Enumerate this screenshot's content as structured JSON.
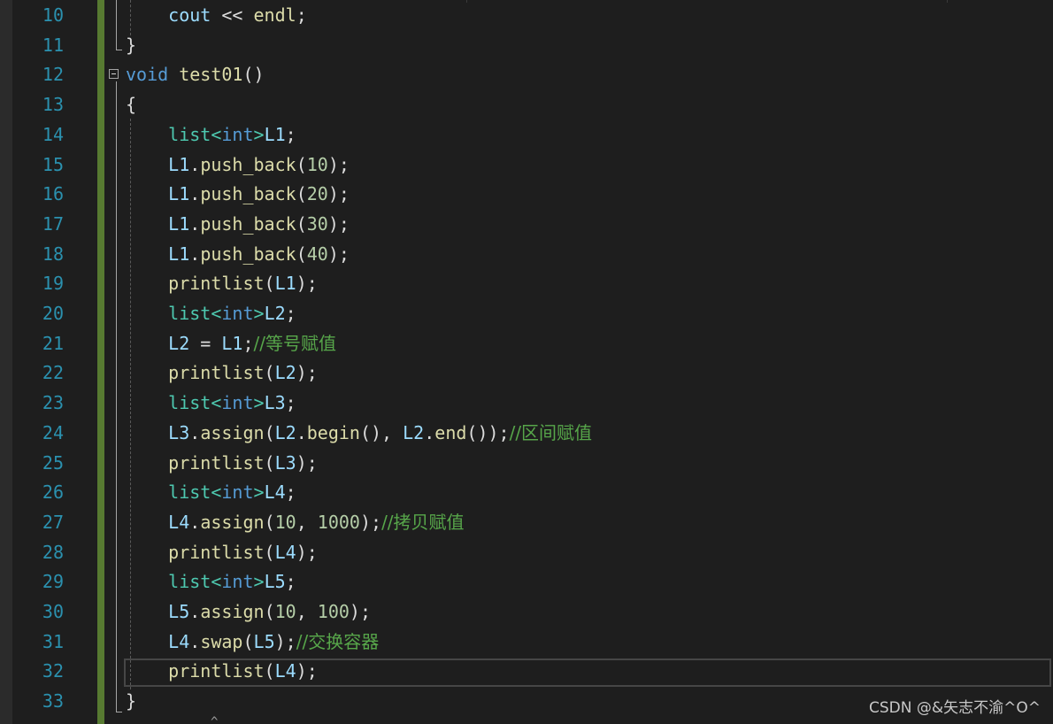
{
  "editor": {
    "colors": {
      "background": "#1e1e1e",
      "line_number": "#2b91af",
      "keyword": "#569cd6",
      "type": "#4ec9b0",
      "function": "#dcdcaa",
      "variable": "#9cdcfe",
      "number": "#b5cea8",
      "comment": "#57a64a",
      "punctuation": "#dcdcdc",
      "change_bar": "#577a31"
    },
    "lines": [
      {
        "num": "10",
        "tokens": [
          {
            "t": "    "
          },
          {
            "t": "cout",
            "c": "var"
          },
          {
            "t": " << "
          },
          {
            "t": "endl",
            "c": "fn"
          },
          {
            "t": ";"
          }
        ]
      },
      {
        "num": "11",
        "tokens": [
          {
            "t": "}"
          }
        ]
      },
      {
        "num": "12",
        "tokens": [
          {
            "t": "void",
            "c": "kw"
          },
          {
            "t": " "
          },
          {
            "t": "test01",
            "c": "fn"
          },
          {
            "t": "()"
          }
        ]
      },
      {
        "num": "13",
        "tokens": [
          {
            "t": "{"
          }
        ]
      },
      {
        "num": "14",
        "tokens": [
          {
            "t": "    "
          },
          {
            "t": "list",
            "c": "type"
          },
          {
            "t": "<",
            "c": "type"
          },
          {
            "t": "int",
            "c": "kw"
          },
          {
            "t": ">",
            "c": "type"
          },
          {
            "t": "L1",
            "c": "var"
          },
          {
            "t": ";"
          }
        ]
      },
      {
        "num": "15",
        "tokens": [
          {
            "t": "    "
          },
          {
            "t": "L1",
            "c": "var"
          },
          {
            "t": "."
          },
          {
            "t": "push_back",
            "c": "fn"
          },
          {
            "t": "("
          },
          {
            "t": "10",
            "c": "num"
          },
          {
            "t": ");"
          }
        ]
      },
      {
        "num": "16",
        "tokens": [
          {
            "t": "    "
          },
          {
            "t": "L1",
            "c": "var"
          },
          {
            "t": "."
          },
          {
            "t": "push_back",
            "c": "fn"
          },
          {
            "t": "("
          },
          {
            "t": "20",
            "c": "num"
          },
          {
            "t": ");"
          }
        ]
      },
      {
        "num": "17",
        "tokens": [
          {
            "t": "    "
          },
          {
            "t": "L1",
            "c": "var"
          },
          {
            "t": "."
          },
          {
            "t": "push_back",
            "c": "fn"
          },
          {
            "t": "("
          },
          {
            "t": "30",
            "c": "num"
          },
          {
            "t": ");"
          }
        ]
      },
      {
        "num": "18",
        "tokens": [
          {
            "t": "    "
          },
          {
            "t": "L1",
            "c": "var"
          },
          {
            "t": "."
          },
          {
            "t": "push_back",
            "c": "fn"
          },
          {
            "t": "("
          },
          {
            "t": "40",
            "c": "num"
          },
          {
            "t": ");"
          }
        ]
      },
      {
        "num": "19",
        "tokens": [
          {
            "t": "    "
          },
          {
            "t": "printlist",
            "c": "fn"
          },
          {
            "t": "("
          },
          {
            "t": "L1",
            "c": "var"
          },
          {
            "t": ");"
          }
        ]
      },
      {
        "num": "20",
        "tokens": [
          {
            "t": "    "
          },
          {
            "t": "list",
            "c": "type"
          },
          {
            "t": "<",
            "c": "type"
          },
          {
            "t": "int",
            "c": "kw"
          },
          {
            "t": ">",
            "c": "type"
          },
          {
            "t": "L2",
            "c": "var"
          },
          {
            "t": ";"
          }
        ]
      },
      {
        "num": "21",
        "tokens": [
          {
            "t": "    "
          },
          {
            "t": "L2",
            "c": "var"
          },
          {
            "t": " = "
          },
          {
            "t": "L1",
            "c": "var"
          },
          {
            "t": ";"
          },
          {
            "t": "//等号赋值",
            "c": "cm"
          }
        ]
      },
      {
        "num": "22",
        "tokens": [
          {
            "t": "    "
          },
          {
            "t": "printlist",
            "c": "fn"
          },
          {
            "t": "("
          },
          {
            "t": "L2",
            "c": "var"
          },
          {
            "t": ");"
          }
        ]
      },
      {
        "num": "23",
        "tokens": [
          {
            "t": "    "
          },
          {
            "t": "list",
            "c": "type"
          },
          {
            "t": "<",
            "c": "type"
          },
          {
            "t": "int",
            "c": "kw"
          },
          {
            "t": ">",
            "c": "type"
          },
          {
            "t": "L3",
            "c": "var"
          },
          {
            "t": ";"
          }
        ]
      },
      {
        "num": "24",
        "tokens": [
          {
            "t": "    "
          },
          {
            "t": "L3",
            "c": "var"
          },
          {
            "t": "."
          },
          {
            "t": "assign",
            "c": "fn"
          },
          {
            "t": "("
          },
          {
            "t": "L2",
            "c": "var"
          },
          {
            "t": "."
          },
          {
            "t": "begin",
            "c": "fn"
          },
          {
            "t": "(), "
          },
          {
            "t": "L2",
            "c": "var"
          },
          {
            "t": "."
          },
          {
            "t": "end",
            "c": "fn"
          },
          {
            "t": "());"
          },
          {
            "t": "//区间赋值",
            "c": "cm"
          }
        ]
      },
      {
        "num": "25",
        "tokens": [
          {
            "t": "    "
          },
          {
            "t": "printlist",
            "c": "fn"
          },
          {
            "t": "("
          },
          {
            "t": "L3",
            "c": "var"
          },
          {
            "t": ");"
          }
        ]
      },
      {
        "num": "26",
        "tokens": [
          {
            "t": "    "
          },
          {
            "t": "list",
            "c": "type"
          },
          {
            "t": "<",
            "c": "type"
          },
          {
            "t": "int",
            "c": "kw"
          },
          {
            "t": ">",
            "c": "type"
          },
          {
            "t": "L4",
            "c": "var"
          },
          {
            "t": ";"
          }
        ]
      },
      {
        "num": "27",
        "tokens": [
          {
            "t": "    "
          },
          {
            "t": "L4",
            "c": "var"
          },
          {
            "t": "."
          },
          {
            "t": "assign",
            "c": "fn"
          },
          {
            "t": "("
          },
          {
            "t": "10",
            "c": "num"
          },
          {
            "t": ", "
          },
          {
            "t": "1000",
            "c": "num"
          },
          {
            "t": ");"
          },
          {
            "t": "//拷贝赋值",
            "c": "cm"
          }
        ]
      },
      {
        "num": "28",
        "tokens": [
          {
            "t": "    "
          },
          {
            "t": "printlist",
            "c": "fn"
          },
          {
            "t": "("
          },
          {
            "t": "L4",
            "c": "var"
          },
          {
            "t": ");"
          }
        ]
      },
      {
        "num": "29",
        "tokens": [
          {
            "t": "    "
          },
          {
            "t": "list",
            "c": "type"
          },
          {
            "t": "<",
            "c": "type"
          },
          {
            "t": "int",
            "c": "kw"
          },
          {
            "t": ">",
            "c": "type"
          },
          {
            "t": "L5",
            "c": "var"
          },
          {
            "t": ";"
          }
        ]
      },
      {
        "num": "30",
        "tokens": [
          {
            "t": "    "
          },
          {
            "t": "L5",
            "c": "var"
          },
          {
            "t": "."
          },
          {
            "t": "assign",
            "c": "fn"
          },
          {
            "t": "("
          },
          {
            "t": "10",
            "c": "num"
          },
          {
            "t": ", "
          },
          {
            "t": "100",
            "c": "num"
          },
          {
            "t": ");"
          }
        ]
      },
      {
        "num": "31",
        "tokens": [
          {
            "t": "    "
          },
          {
            "t": "L4",
            "c": "var"
          },
          {
            "t": "."
          },
          {
            "t": "swap",
            "c": "fn"
          },
          {
            "t": "("
          },
          {
            "t": "L5",
            "c": "var"
          },
          {
            "t": ");"
          },
          {
            "t": "//交换容器",
            "c": "cm"
          }
        ]
      },
      {
        "num": "32",
        "tokens": [
          {
            "t": "    "
          },
          {
            "t": "printlist",
            "c": "fn"
          },
          {
            "t": "("
          },
          {
            "t": "L4",
            "c": "var"
          },
          {
            "t": ");"
          }
        ]
      },
      {
        "num": "33",
        "tokens": [
          {
            "t": "}"
          }
        ]
      }
    ]
  },
  "watermark": {
    "text": "CSDN @&矢志不渝^O^"
  },
  "icons": {
    "collapse": "collapse-minus-icon"
  }
}
